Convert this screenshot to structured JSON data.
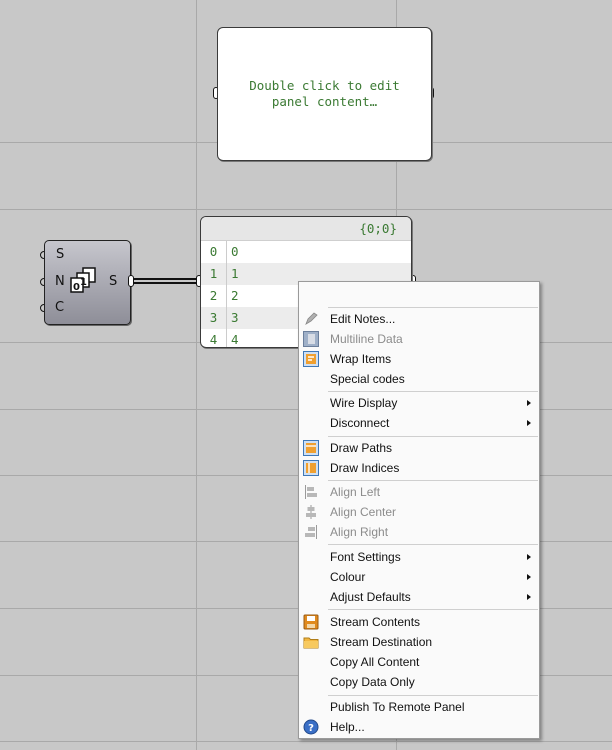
{
  "panel_empty": {
    "line1": "Double click to edit",
    "line2": "panel content…"
  },
  "series_component": {
    "inputs": [
      "S",
      "N",
      "C"
    ],
    "output": "S"
  },
  "data_panel": {
    "path": "{0;0}",
    "rows": [
      {
        "index": "0",
        "value": "0"
      },
      {
        "index": "1",
        "value": "1"
      },
      {
        "index": "2",
        "value": "2"
      },
      {
        "index": "3",
        "value": "3"
      },
      {
        "index": "4",
        "value": "4"
      }
    ]
  },
  "context_menu": {
    "items": [
      {
        "label": "Edit Notes...",
        "icon": "pencil-icon",
        "enabled": true
      },
      {
        "label": "Multiline Data",
        "icon": "multiline-icon",
        "enabled": false
      },
      {
        "label": "Wrap Items",
        "icon": "wrap-icon",
        "enabled": true
      },
      {
        "label": "Special codes",
        "icon": "",
        "enabled": true
      },
      {
        "label": "Wire Display",
        "submenu": true,
        "enabled": true
      },
      {
        "label": "Disconnect",
        "submenu": true,
        "enabled": true
      },
      {
        "label": "Draw Paths",
        "icon": "draw-paths-icon",
        "enabled": true
      },
      {
        "label": "Draw Indices",
        "icon": "draw-indices-icon",
        "enabled": true
      },
      {
        "label": "Align Left",
        "icon": "align-left-icon",
        "enabled": false
      },
      {
        "label": "Align Center",
        "icon": "align-center-icon",
        "enabled": false
      },
      {
        "label": "Align Right",
        "icon": "align-right-icon",
        "enabled": false
      },
      {
        "label": "Font Settings",
        "submenu": true,
        "enabled": true
      },
      {
        "label": "Colour",
        "submenu": true,
        "enabled": true
      },
      {
        "label": "Adjust Defaults",
        "submenu": true,
        "enabled": true
      },
      {
        "label": "Stream Contents",
        "icon": "save-disk-icon",
        "enabled": true
      },
      {
        "label": "Stream Destination",
        "icon": "folder-icon",
        "enabled": true
      },
      {
        "label": "Copy All Content",
        "icon": "",
        "enabled": true
      },
      {
        "label": "Copy Data Only",
        "icon": "",
        "enabled": true
      },
      {
        "label": "Publish To Remote Panel",
        "icon": "",
        "enabled": true
      },
      {
        "label": "Help...",
        "icon": "help-icon",
        "enabled": true
      }
    ]
  },
  "colors": {
    "canvas": "#c8c8c8",
    "grid_line": "#a9a9a9",
    "panel_text": "#3b7a33",
    "menu_bg": "#fafafa",
    "disabled_text": "#8c8c8c"
  }
}
